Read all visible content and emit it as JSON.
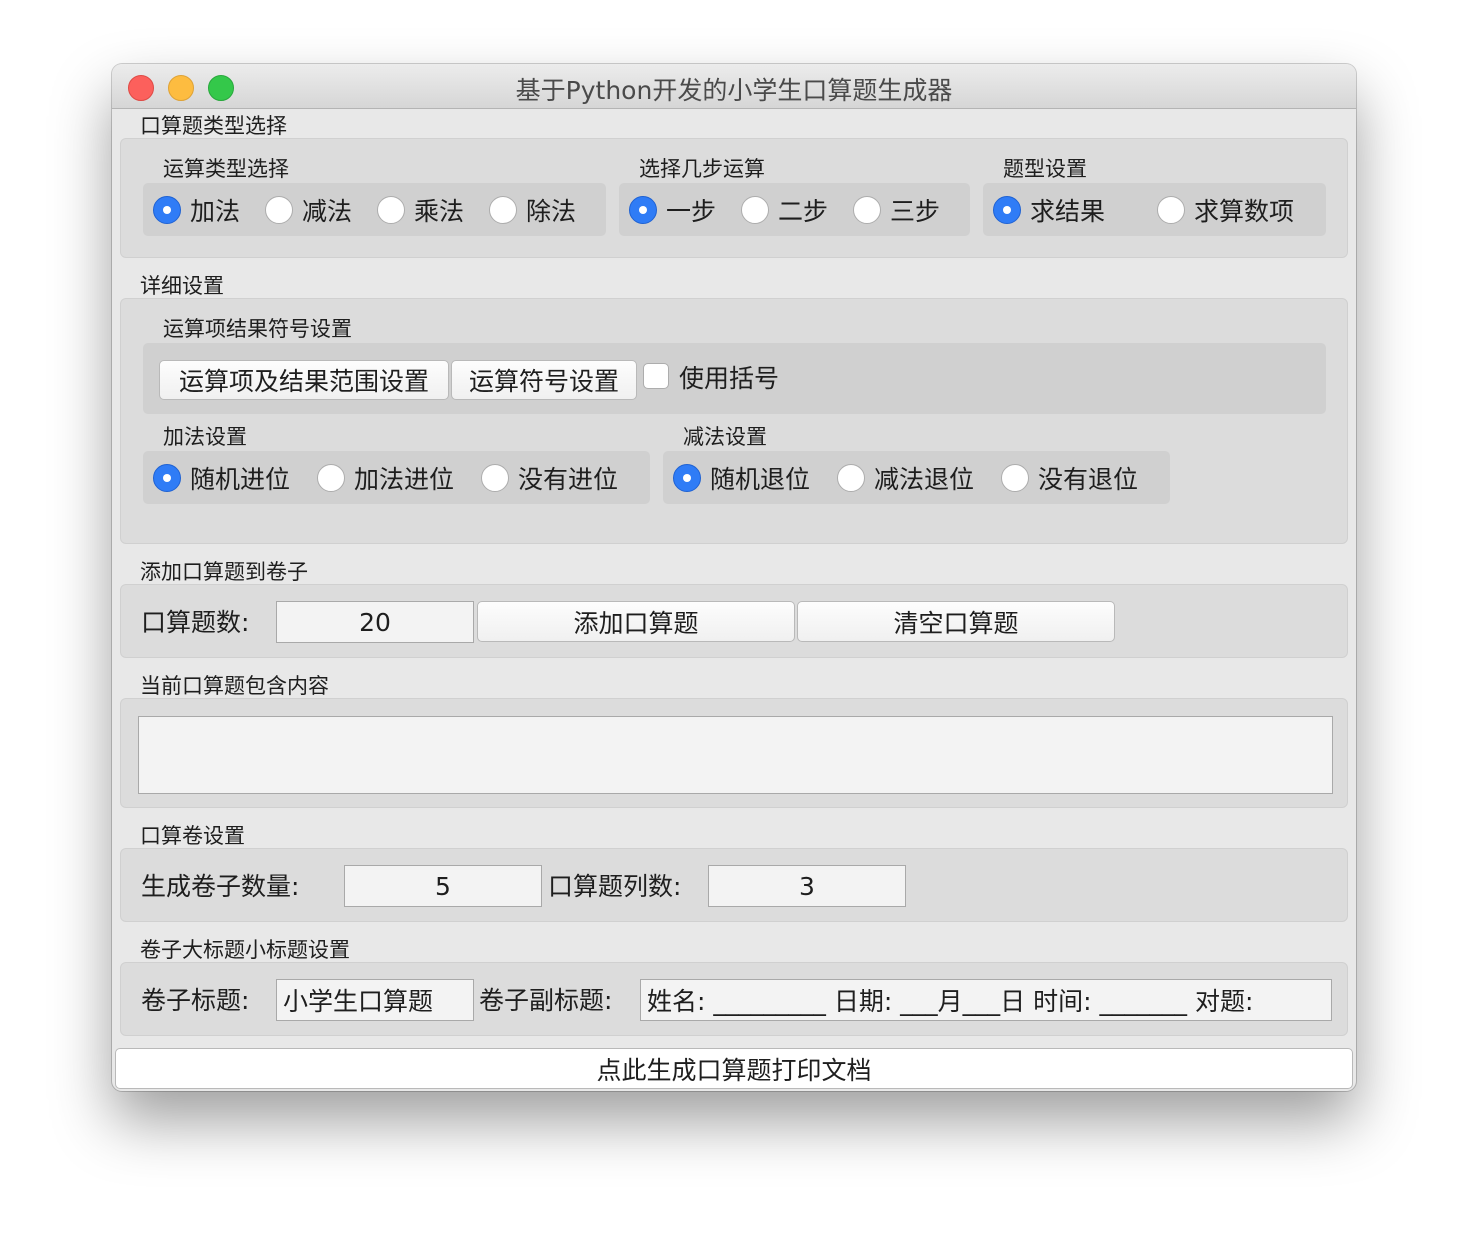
{
  "window": {
    "title": "基于Python开发的小学生口算题生成器"
  },
  "type_section": {
    "label": "口算题类型选择",
    "op_type": {
      "label": "运算类型选择",
      "options": [
        "加法",
        "减法",
        "乘法",
        "除法"
      ],
      "selected": 0
    },
    "steps": {
      "label": "选择几步运算",
      "options": [
        "一步",
        "二步",
        "三步"
      ],
      "selected": 0
    },
    "question_type": {
      "label": "题型设置",
      "options": [
        "求结果",
        "求算数项"
      ],
      "selected": 0
    }
  },
  "detail_section": {
    "label": "详细设置",
    "symbol": {
      "label": "运算项结果符号设置",
      "range_button": "运算项及结果范围设置",
      "operator_button": "运算符号设置",
      "brackets_label": "使用括号",
      "brackets_checked": false
    },
    "addition": {
      "label": "加法设置",
      "options": [
        "随机进位",
        "加法进位",
        "没有进位"
      ],
      "selected": 0
    },
    "subtraction": {
      "label": "减法设置",
      "options": [
        "随机退位",
        "减法退位",
        "没有退位"
      ],
      "selected": 0
    }
  },
  "add_section": {
    "label": "添加口算题到卷子",
    "count_label": "口算题数:",
    "count_value": "20",
    "add_button": "添加口算题",
    "clear_button": "清空口算题"
  },
  "content_section": {
    "label": "当前口算题包含内容",
    "value": ""
  },
  "paper_section": {
    "label": "口算卷设置",
    "count_label": "生成卷子数量:",
    "count_value": "5",
    "columns_label": "口算题列数:",
    "columns_value": "3"
  },
  "title_section": {
    "label": "卷子大标题小标题设置",
    "title_label": "卷子标题:",
    "title_value": "小学生口算题",
    "subtitle_label": "卷子副标题:",
    "subtitle_value": "姓名: _________ 日期: ___月___日 时间: _______ 对题:"
  },
  "generate_button": "点此生成口算题打印文档"
}
